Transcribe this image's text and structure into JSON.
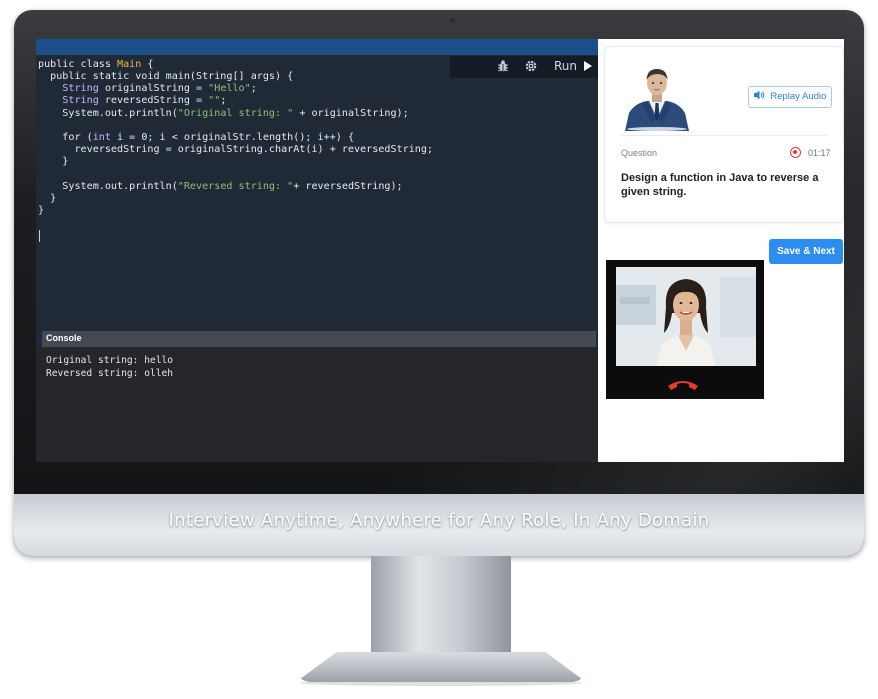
{
  "editor": {
    "run_label": "Run",
    "code_lines": [
      {
        "parts": [
          {
            "t": "public class ",
            "c": "kw"
          },
          {
            "t": "Main",
            "c": "cls"
          },
          {
            "t": " {",
            "c": "kw"
          }
        ]
      },
      {
        "parts": [
          {
            "t": "  public static void main(String[] args) {",
            "c": "kw"
          }
        ]
      },
      {
        "parts": [
          {
            "t": "    ",
            "c": "kw"
          },
          {
            "t": "String",
            "c": "typ"
          },
          {
            "t": " originalString = ",
            "c": "kw"
          },
          {
            "t": "\"Hello\"",
            "c": "str"
          },
          {
            "t": ";",
            "c": "kw"
          }
        ]
      },
      {
        "parts": [
          {
            "t": "    ",
            "c": "kw"
          },
          {
            "t": "String",
            "c": "typ"
          },
          {
            "t": " reversedString = ",
            "c": "kw"
          },
          {
            "t": "\"\"",
            "c": "str"
          },
          {
            "t": ";",
            "c": "kw"
          }
        ]
      },
      {
        "parts": [
          {
            "t": "    System.out.println(",
            "c": "kw"
          },
          {
            "t": "\"Original string: \"",
            "c": "str"
          },
          {
            "t": " + originalString);",
            "c": "kw"
          }
        ]
      },
      {
        "parts": [
          {
            "t": "",
            "c": "kw"
          }
        ]
      },
      {
        "parts": [
          {
            "t": "    for (",
            "c": "kw"
          },
          {
            "t": "int",
            "c": "typ"
          },
          {
            "t": " i = 0; i < originalStr.length(); i++) {",
            "c": "kw"
          }
        ]
      },
      {
        "parts": [
          {
            "t": "      reversedString = originalString.charAt(i) + reversedString;",
            "c": "kw"
          }
        ]
      },
      {
        "parts": [
          {
            "t": "    }",
            "c": "kw"
          }
        ]
      },
      {
        "parts": [
          {
            "t": "",
            "c": "kw"
          }
        ]
      },
      {
        "parts": [
          {
            "t": "    System.out.println(",
            "c": "kw"
          },
          {
            "t": "\"Reversed string: \"",
            "c": "str"
          },
          {
            "t": "+ reversedString);",
            "c": "kw"
          }
        ]
      },
      {
        "parts": [
          {
            "t": "  }",
            "c": "kw"
          }
        ]
      },
      {
        "parts": [
          {
            "t": "}",
            "c": "kw"
          }
        ]
      }
    ]
  },
  "console": {
    "title": "Console",
    "lines": [
      "Original string: hello",
      "Reversed string: olleh"
    ]
  },
  "question_panel": {
    "replay_label": "Replay Audio",
    "question_label": "Question",
    "timer": "01:17",
    "question_text": "Design a function in Java to reverse a given string."
  },
  "save_next_label": "Save & Next",
  "tagline": "Interview Anytime, Anywhere for Any Role, In Any Domain",
  "colors": {
    "accent": "#2d8cf0",
    "recording": "#e53935",
    "hangup": "#e53935",
    "editor_bg": "#1f2a36"
  },
  "icons": [
    "bug-icon",
    "settings-icon",
    "play-icon",
    "speaker-icon",
    "record-icon",
    "phone-hangup-icon"
  ]
}
